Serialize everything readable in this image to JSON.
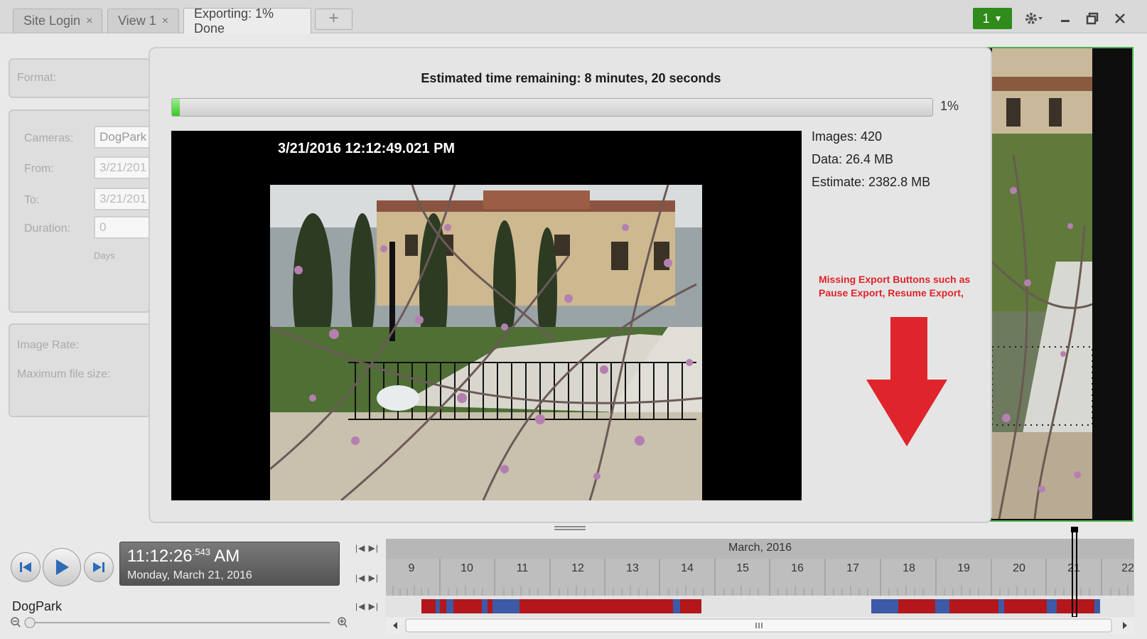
{
  "tabs": [
    {
      "label": "Site Login",
      "close": "×"
    },
    {
      "label": "View 1",
      "close": "×"
    },
    {
      "label": "Exporting: 1% Done"
    }
  ],
  "add_tab_label": "+",
  "counter_label": "1",
  "left_panel": {
    "format_label": "Format:",
    "cameras_label": "Cameras:",
    "cameras_value": "DogPark",
    "from_label": "From:",
    "from_value": "3/21/201",
    "to_label": "To:",
    "to_value": "3/21/201",
    "duration_label": "Duration:",
    "duration_value": "0",
    "duration_unit": "Days",
    "image_rate_label": "Image Rate:",
    "max_file_size_label": "Maximum file size:"
  },
  "dialog": {
    "estimated_time": "Estimated time remaining: 8 minutes, 20 seconds",
    "progress_fraction": 0.01,
    "progress_label": "1%",
    "video_timestamp": "3/21/2016 12:12:49.021 PM",
    "images": "Images: 420",
    "data": "Data: 26.4 MB",
    "estimate": "Estimate: 2382.8 MB",
    "annotation": "Missing Export Buttons such as Pause Export, Resume Export,",
    "annotation_color": "#e0242b"
  },
  "clock": {
    "time": "11:12:26",
    "ms": ".543",
    "ampm": "AM",
    "date": "Monday, March 21, 2016"
  },
  "camera_name": "DogPark",
  "timeline": {
    "month": "March, 2016",
    "days": [
      "9",
      "10",
      "11",
      "12",
      "13",
      "14",
      "15",
      "16",
      "17",
      "18",
      "19",
      "20",
      "21",
      "22"
    ]
  },
  "colors": {
    "counter_bg": "#2e8b1c",
    "recording": "#b3171c",
    "motion": "#3d5aa6",
    "active_border": "#4bb04b"
  },
  "icons": {
    "gear": "gear-icon",
    "minimize": "minimize-icon",
    "restore": "restore-icon",
    "close": "close-icon",
    "zoom_out": "zoom-out-icon",
    "zoom_in": "zoom-in-icon"
  }
}
